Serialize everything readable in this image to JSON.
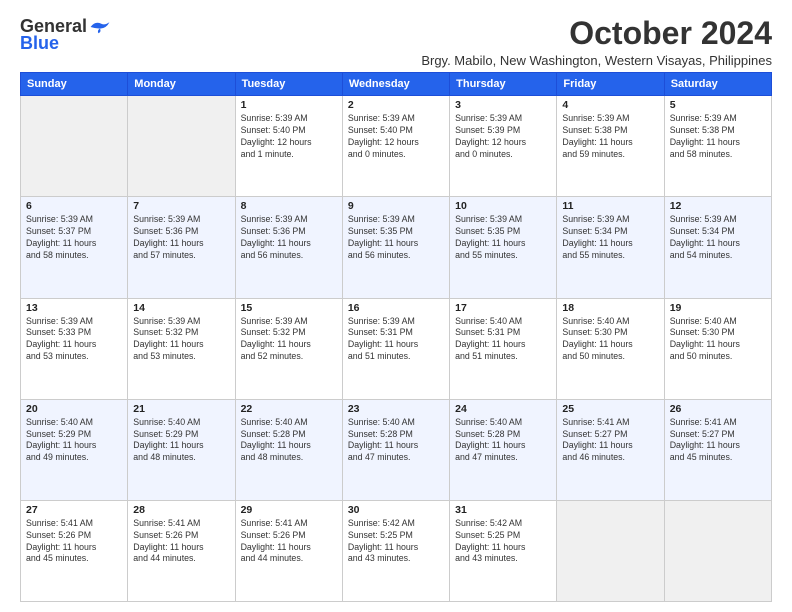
{
  "logo": {
    "general": "General",
    "blue": "Blue"
  },
  "title": "October 2024",
  "subtitle": "Brgy. Mabilo, New Washington, Western Visayas, Philippines",
  "days_of_week": [
    "Sunday",
    "Monday",
    "Tuesday",
    "Wednesday",
    "Thursday",
    "Friday",
    "Saturday"
  ],
  "weeks": [
    [
      {
        "day": "",
        "info": ""
      },
      {
        "day": "",
        "info": ""
      },
      {
        "day": "1",
        "info": "Sunrise: 5:39 AM\nSunset: 5:40 PM\nDaylight: 12 hours\nand 1 minute."
      },
      {
        "day": "2",
        "info": "Sunrise: 5:39 AM\nSunset: 5:40 PM\nDaylight: 12 hours\nand 0 minutes."
      },
      {
        "day": "3",
        "info": "Sunrise: 5:39 AM\nSunset: 5:39 PM\nDaylight: 12 hours\nand 0 minutes."
      },
      {
        "day": "4",
        "info": "Sunrise: 5:39 AM\nSunset: 5:38 PM\nDaylight: 11 hours\nand 59 minutes."
      },
      {
        "day": "5",
        "info": "Sunrise: 5:39 AM\nSunset: 5:38 PM\nDaylight: 11 hours\nand 58 minutes."
      }
    ],
    [
      {
        "day": "6",
        "info": "Sunrise: 5:39 AM\nSunset: 5:37 PM\nDaylight: 11 hours\nand 58 minutes."
      },
      {
        "day": "7",
        "info": "Sunrise: 5:39 AM\nSunset: 5:36 PM\nDaylight: 11 hours\nand 57 minutes."
      },
      {
        "day": "8",
        "info": "Sunrise: 5:39 AM\nSunset: 5:36 PM\nDaylight: 11 hours\nand 56 minutes."
      },
      {
        "day": "9",
        "info": "Sunrise: 5:39 AM\nSunset: 5:35 PM\nDaylight: 11 hours\nand 56 minutes."
      },
      {
        "day": "10",
        "info": "Sunrise: 5:39 AM\nSunset: 5:35 PM\nDaylight: 11 hours\nand 55 minutes."
      },
      {
        "day": "11",
        "info": "Sunrise: 5:39 AM\nSunset: 5:34 PM\nDaylight: 11 hours\nand 55 minutes."
      },
      {
        "day": "12",
        "info": "Sunrise: 5:39 AM\nSunset: 5:34 PM\nDaylight: 11 hours\nand 54 minutes."
      }
    ],
    [
      {
        "day": "13",
        "info": "Sunrise: 5:39 AM\nSunset: 5:33 PM\nDaylight: 11 hours\nand 53 minutes."
      },
      {
        "day": "14",
        "info": "Sunrise: 5:39 AM\nSunset: 5:32 PM\nDaylight: 11 hours\nand 53 minutes."
      },
      {
        "day": "15",
        "info": "Sunrise: 5:39 AM\nSunset: 5:32 PM\nDaylight: 11 hours\nand 52 minutes."
      },
      {
        "day": "16",
        "info": "Sunrise: 5:39 AM\nSunset: 5:31 PM\nDaylight: 11 hours\nand 51 minutes."
      },
      {
        "day": "17",
        "info": "Sunrise: 5:40 AM\nSunset: 5:31 PM\nDaylight: 11 hours\nand 51 minutes."
      },
      {
        "day": "18",
        "info": "Sunrise: 5:40 AM\nSunset: 5:30 PM\nDaylight: 11 hours\nand 50 minutes."
      },
      {
        "day": "19",
        "info": "Sunrise: 5:40 AM\nSunset: 5:30 PM\nDaylight: 11 hours\nand 50 minutes."
      }
    ],
    [
      {
        "day": "20",
        "info": "Sunrise: 5:40 AM\nSunset: 5:29 PM\nDaylight: 11 hours\nand 49 minutes."
      },
      {
        "day": "21",
        "info": "Sunrise: 5:40 AM\nSunset: 5:29 PM\nDaylight: 11 hours\nand 48 minutes."
      },
      {
        "day": "22",
        "info": "Sunrise: 5:40 AM\nSunset: 5:28 PM\nDaylight: 11 hours\nand 48 minutes."
      },
      {
        "day": "23",
        "info": "Sunrise: 5:40 AM\nSunset: 5:28 PM\nDaylight: 11 hours\nand 47 minutes."
      },
      {
        "day": "24",
        "info": "Sunrise: 5:40 AM\nSunset: 5:28 PM\nDaylight: 11 hours\nand 47 minutes."
      },
      {
        "day": "25",
        "info": "Sunrise: 5:41 AM\nSunset: 5:27 PM\nDaylight: 11 hours\nand 46 minutes."
      },
      {
        "day": "26",
        "info": "Sunrise: 5:41 AM\nSunset: 5:27 PM\nDaylight: 11 hours\nand 45 minutes."
      }
    ],
    [
      {
        "day": "27",
        "info": "Sunrise: 5:41 AM\nSunset: 5:26 PM\nDaylight: 11 hours\nand 45 minutes."
      },
      {
        "day": "28",
        "info": "Sunrise: 5:41 AM\nSunset: 5:26 PM\nDaylight: 11 hours\nand 44 minutes."
      },
      {
        "day": "29",
        "info": "Sunrise: 5:41 AM\nSunset: 5:26 PM\nDaylight: 11 hours\nand 44 minutes."
      },
      {
        "day": "30",
        "info": "Sunrise: 5:42 AM\nSunset: 5:25 PM\nDaylight: 11 hours\nand 43 minutes."
      },
      {
        "day": "31",
        "info": "Sunrise: 5:42 AM\nSunset: 5:25 PM\nDaylight: 11 hours\nand 43 minutes."
      },
      {
        "day": "",
        "info": ""
      },
      {
        "day": "",
        "info": ""
      }
    ]
  ]
}
